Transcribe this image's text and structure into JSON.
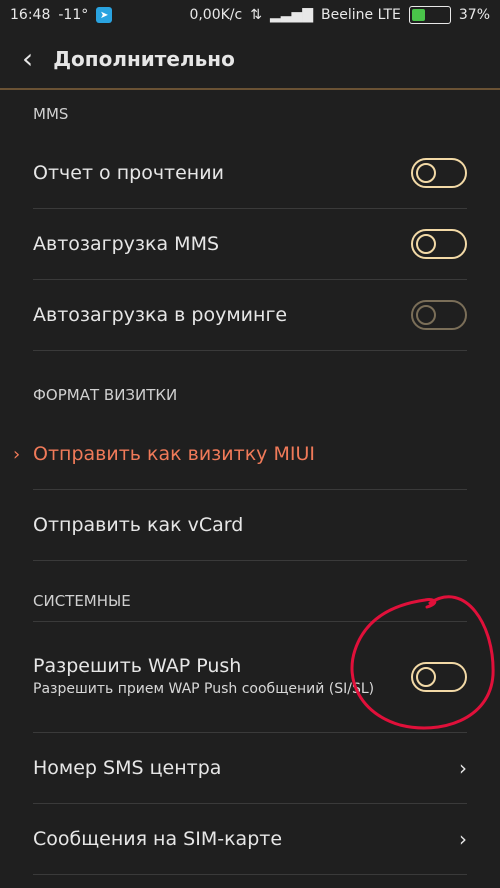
{
  "statusbar": {
    "time": "16:48",
    "temp": "-11°",
    "speed": "0,00K/c",
    "carrier": "Beeline LTE",
    "battery": "37%",
    "battery_level": 37
  },
  "header": {
    "title": "Дополнительно"
  },
  "sections": {
    "mms": {
      "title": "MMS"
    },
    "vcard": {
      "title": "ФОРМАТ ВИЗИТКИ"
    },
    "system": {
      "title": "СИСТЕМНЫЕ"
    }
  },
  "rows": {
    "read_report": "Отчет о прочтении",
    "auto_mms": "Автозагрузка MMS",
    "auto_roaming": "Автозагрузка в роуминге",
    "send_miui": "Отправить как визитку MIUI",
    "send_vcard": "Отправить как vCard",
    "wap_title": "Разрешить WAP Push",
    "wap_subtitle": "Разрешить прием WAP Push сообщений (SI/SL)",
    "sms_center": "Номер SMS центра",
    "sim_messages": "Сообщения на SIM-карте"
  },
  "colors": {
    "accent": "#f07a59",
    "toggle": "#f2d9a6",
    "annotation": "#e0103a"
  },
  "icons": {
    "back": "back-chevron-icon",
    "selected": "selected-chevron-icon",
    "chevron": "chevron-right-icon"
  }
}
